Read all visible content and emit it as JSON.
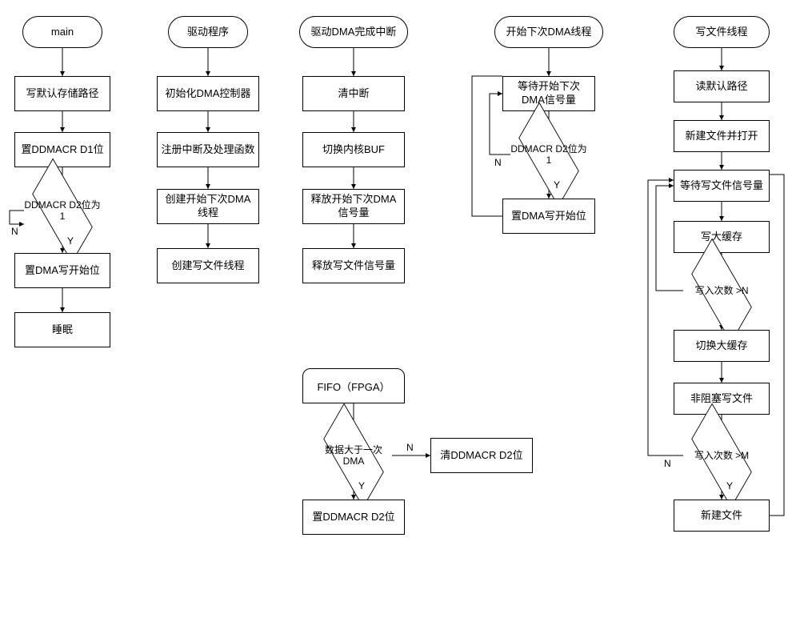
{
  "chart_data": {
    "type": "flowchart",
    "lanes": [
      {
        "id": "main",
        "title": "main"
      },
      {
        "id": "driver",
        "title": "驱动程序"
      },
      {
        "id": "dma_int",
        "title": "驱动DMA完成中断"
      },
      {
        "id": "next_dma",
        "title": "开始下次DMA线程"
      },
      {
        "id": "write_file",
        "title": "写文件线程"
      },
      {
        "id": "fpga",
        "title": "FIFO（FPGA）"
      }
    ]
  },
  "col1": {
    "start": "main",
    "n1": "写默认存储路径",
    "n2": "置DDMACR D1位",
    "d1": "DDMACR D2位为1",
    "n3": "置DMA写开始位",
    "n4": "睡眠",
    "no": "N",
    "yes": "Y"
  },
  "col2": {
    "start": "驱动程序",
    "n1": "初始化DMA控制器",
    "n2": "注册中断及处理函数",
    "n3": "创建开始下次DMA线程",
    "n4": "创建写文件线程"
  },
  "col3": {
    "start": "驱动DMA完成中断",
    "n1": "清中断",
    "n2": "切换内核BUF",
    "n3": "释放开始下次DMA信号量",
    "n4": "释放写文件信号量"
  },
  "col4": {
    "start": "开始下次DMA线程",
    "n1": "等待开始下次DMA信号量",
    "d1": "DDMACR D2位为1",
    "n2": "置DMA写开始位",
    "no": "N",
    "yes": "Y"
  },
  "col5": {
    "start": "写文件线程",
    "n1": "读默认路径",
    "n2": "新建文件并打开",
    "n3": "等待写文件信号量",
    "n4": "写大缓存",
    "d1": "写入次数 >N",
    "n5": "切换大缓存",
    "n6": "非阻塞写文件",
    "d2": "写入次数 >M",
    "n7": "新建文件",
    "no": "N",
    "yes": "Y"
  },
  "fpga": {
    "start": "FIFO（FPGA）",
    "d1": "数据大于一次DMA",
    "n1": "置DDMACR D2位",
    "n2": "清DDMACR D2位",
    "no": "N",
    "yes": "Y"
  }
}
